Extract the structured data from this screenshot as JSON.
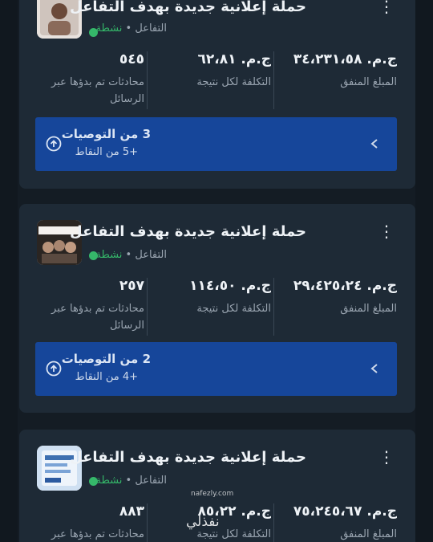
{
  "colors": {
    "background": "#141c24",
    "card": "#1e2a36",
    "active_status": "#35b86a",
    "recommendation_bg": "#16469a"
  },
  "campaigns": [
    {
      "title": "حملة إعلانية جديدة بهدف التفاعل",
      "objective": "التفاعل",
      "separator": "•",
      "status": "نشطة",
      "spent_value": "ج.م. ٣٤،٢٣١،٥٨",
      "spent_label": "المبلغ المنفق",
      "cost_value": "ج.م. ٦٢،٨١",
      "cost_label": "التكلفة لكل نتيجة",
      "result_value": "٥٤٥",
      "result_label": "محادثات تم بدؤها عبر الرسائل",
      "reco_title": "3 من التوصيات",
      "reco_points": "+5 من النقاط",
      "thumb_icon": "person-photo-thumbnail"
    },
    {
      "title": "حملة إعلانية جديدة بهدف التفاعل",
      "objective": "التفاعل",
      "separator": "•",
      "status": "نشطة",
      "spent_value": "ج.م. ٢٩،٤٢٥،٢٤",
      "spent_label": "المبلغ المنفق",
      "cost_value": "ج.م. ١١٤،٥٠",
      "cost_label": "التكلفة لكل نتيجة",
      "result_value": "٢٥٧",
      "result_label": "محادثات تم بدؤها عبر الرسائل",
      "reco_title": "2 من التوصيات",
      "reco_points": "+4 من النقاط",
      "thumb_icon": "group-photo-thumbnail"
    },
    {
      "title": "حملة إعلانية جديدة بهدف التفاعل",
      "objective": "التفاعل",
      "separator": "•",
      "status": "نشطة",
      "spent_value": "ج.م. ٧٥،٢٤٥،٦٧",
      "spent_label": "المبلغ المنفق",
      "cost_value": "ج.م. ٨٥،٢٢",
      "cost_label": "التكلفة لكل نتيجة",
      "result_value": "٨٨٣",
      "result_label": "محادثات تم بدؤها عبر",
      "thumb_icon": "flyer-thumbnail"
    }
  ],
  "watermark": {
    "text": "نفذلي",
    "sub": "nafezly.com"
  }
}
